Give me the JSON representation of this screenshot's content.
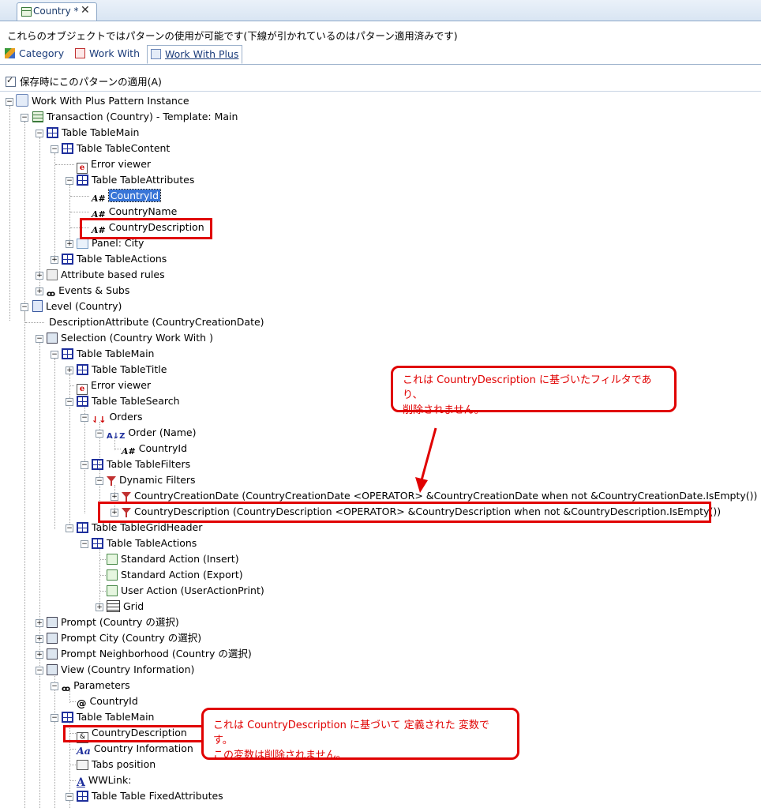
{
  "window": {
    "tab_title": "Country *",
    "close_glyph": "✕"
  },
  "info_text": "これらのオブジェクトではパターンの使用が可能です(下線が引かれているのはパターン適用済みです)",
  "pattern_tabs": [
    {
      "label": "Category",
      "icon": "category-icon"
    },
    {
      "label": "Work With",
      "icon": "workwith-icon"
    },
    {
      "label": "Work With Plus",
      "icon": "workwithplus-icon",
      "active": true
    }
  ],
  "apply_on_save": {
    "label": "保存時にこのパターンの適用(A)",
    "checked": true
  },
  "tree": [
    {
      "label": "Work With Plus Pattern Instance",
      "icon": "wwp-icon"
    },
    {
      "label": "Transaction (Country) - Template: Main",
      "icon": "transaction-icon"
    },
    {
      "label": "Table TableMain",
      "icon": "table-icon"
    },
    {
      "label": "Table TableContent",
      "icon": "table-icon"
    },
    {
      "label": "Error viewer",
      "icon": "error-viewer-icon"
    },
    {
      "label": "Table TableAttributes",
      "icon": "table-icon"
    },
    {
      "label": "CountryId",
      "icon": "attribute-icon",
      "selected": true
    },
    {
      "label": "CountryName",
      "icon": "attribute-icon"
    },
    {
      "label": "CountryDescription",
      "icon": "attribute-icon"
    },
    {
      "label": "Panel: City",
      "icon": "panel-icon"
    },
    {
      "label": "Table TableActions",
      "icon": "table-icon"
    },
    {
      "label": "Attribute based rules",
      "icon": "rules-icon"
    },
    {
      "label": "Events & Subs",
      "icon": "events-icon"
    },
    {
      "label": "Level (Country)",
      "icon": "level-icon"
    },
    {
      "label": "DescriptionAttribute (CountryCreationDate)",
      "icon": ""
    },
    {
      "label": "Selection (Country Work With )",
      "icon": "selection-icon"
    },
    {
      "label": "Table TableMain",
      "icon": "table-icon"
    },
    {
      "label": "Table TableTitle",
      "icon": "table-icon"
    },
    {
      "label": "Error viewer",
      "icon": "error-viewer-icon"
    },
    {
      "label": "Table TableSearch",
      "icon": "table-icon"
    },
    {
      "label": "Orders",
      "icon": "orders-icon"
    },
    {
      "label": "Order (Name)",
      "icon": "order-icon"
    },
    {
      "label": "CountryId",
      "icon": "attribute-icon"
    },
    {
      "label": "Table TableFilters",
      "icon": "table-icon"
    },
    {
      "label": "Dynamic Filters",
      "icon": "filter-icon"
    },
    {
      "label": "CountryCreationDate  (CountryCreationDate  <OPERATOR>  &CountryCreationDate  when  not  &CountryCreationDate.IsEmpty())",
      "icon": "filter-icon"
    },
    {
      "label": "CountryDescription  (CountryDescription  <OPERATOR>  &CountryDescription  when  not  &CountryDescription.IsEmpty())",
      "icon": "filter-icon"
    },
    {
      "label": "Table TableGridHeader",
      "icon": "table-icon"
    },
    {
      "label": "Table TableActions",
      "icon": "table-icon"
    },
    {
      "label": "Standard Action (Insert)",
      "icon": "action-icon"
    },
    {
      "label": "Standard Action (Export)",
      "icon": "action-icon"
    },
    {
      "label": "User Action (UserActionPrint)",
      "icon": "action-icon"
    },
    {
      "label": "Grid",
      "icon": "grid-icon"
    },
    {
      "label": "Prompt   (Country の選択)",
      "icon": "prompt-icon"
    },
    {
      "label": "Prompt  City  (Country の選択)",
      "icon": "prompt-icon"
    },
    {
      "label": "Prompt  Neighborhood  (Country の選択)",
      "icon": "prompt-icon"
    },
    {
      "label": "View (Country Information)",
      "icon": "prompt-icon"
    },
    {
      "label": "Parameters",
      "icon": "events-icon"
    },
    {
      "label": "CountryId",
      "icon": "parameter-icon"
    },
    {
      "label": "Table TableMain",
      "icon": "table-icon"
    },
    {
      "label": "CountryDescription",
      "icon": "variable-icon"
    },
    {
      "label": "Country Information",
      "icon": "textblock-icon"
    },
    {
      "label": "Tabs position",
      "icon": "tabs-icon"
    },
    {
      "label": "WWLink:",
      "icon": "link-icon"
    },
    {
      "label": "Table Table FixedAttributes",
      "icon": "table-icon"
    }
  ],
  "callouts": [
    {
      "lines": [
        "これは CountryDescription に基づいたフィルタであり、",
        "削除されません。"
      ]
    },
    {
      "lines": [
        "これは CountryDescription に基づいて 定義された 変数です。",
        "この変数は削除されません。"
      ]
    }
  ],
  "colors": {
    "highlight": "#e00000",
    "selection": "#3875d7",
    "table_icon": "#1e2f9c"
  }
}
